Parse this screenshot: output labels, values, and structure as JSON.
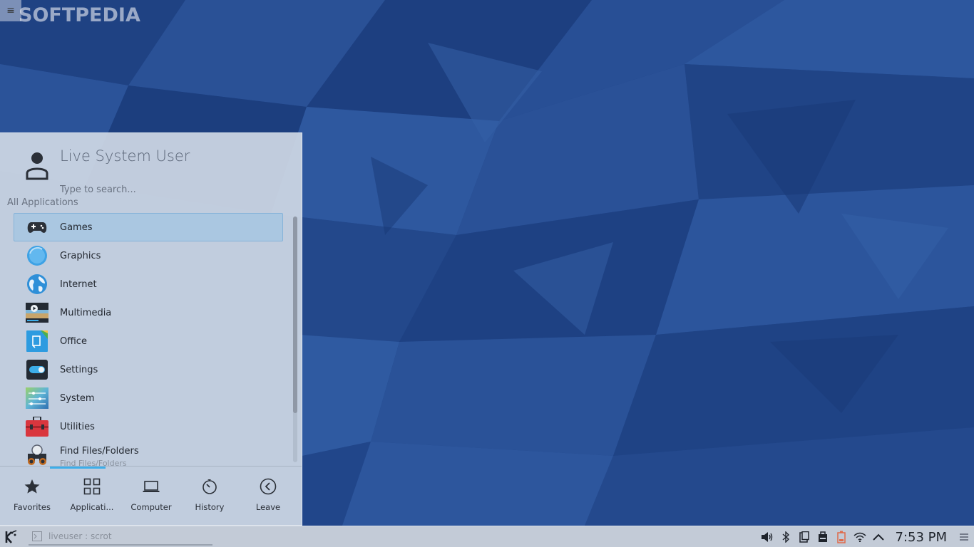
{
  "watermark": "SOFTPEDIA",
  "launcher": {
    "user_name": "Live System User",
    "search_placeholder": "Type to search...",
    "section_label": "All Applications",
    "apps": [
      {
        "label": "Games",
        "icon": "gamepad-icon",
        "selected": true
      },
      {
        "label": "Graphics",
        "icon": "graphics-icon"
      },
      {
        "label": "Internet",
        "icon": "globe-icon"
      },
      {
        "label": "Multimedia",
        "icon": "multimedia-icon"
      },
      {
        "label": "Office",
        "icon": "office-icon"
      },
      {
        "label": "Settings",
        "icon": "settings-toggle-icon"
      },
      {
        "label": "System",
        "icon": "system-icon"
      },
      {
        "label": "Utilities",
        "icon": "toolbox-icon"
      },
      {
        "label": "Find Files/Folders",
        "sublabel": "Find Files/Folders",
        "icon": "binoculars-icon"
      }
    ],
    "tabs": [
      {
        "label": "Favorites",
        "icon": "star-icon"
      },
      {
        "label": "Applicati...",
        "icon": "grid-icon"
      },
      {
        "label": "Computer",
        "icon": "laptop-icon"
      },
      {
        "label": "History",
        "icon": "history-icon"
      },
      {
        "label": "Leave",
        "icon": "leave-icon"
      }
    ]
  },
  "taskbar": {
    "task_label": "liveuser : scrot",
    "clock": "7:53 PM",
    "tray_icons": [
      "volume-icon",
      "bluetooth-icon",
      "clipboard-icon",
      "usb-device-icon",
      "battery-icon",
      "wifi-icon",
      "expand-tray-icon"
    ]
  },
  "colors": {
    "desktop": "#22478a",
    "selection": "#a6c6e2",
    "accent": "#3daee9"
  }
}
